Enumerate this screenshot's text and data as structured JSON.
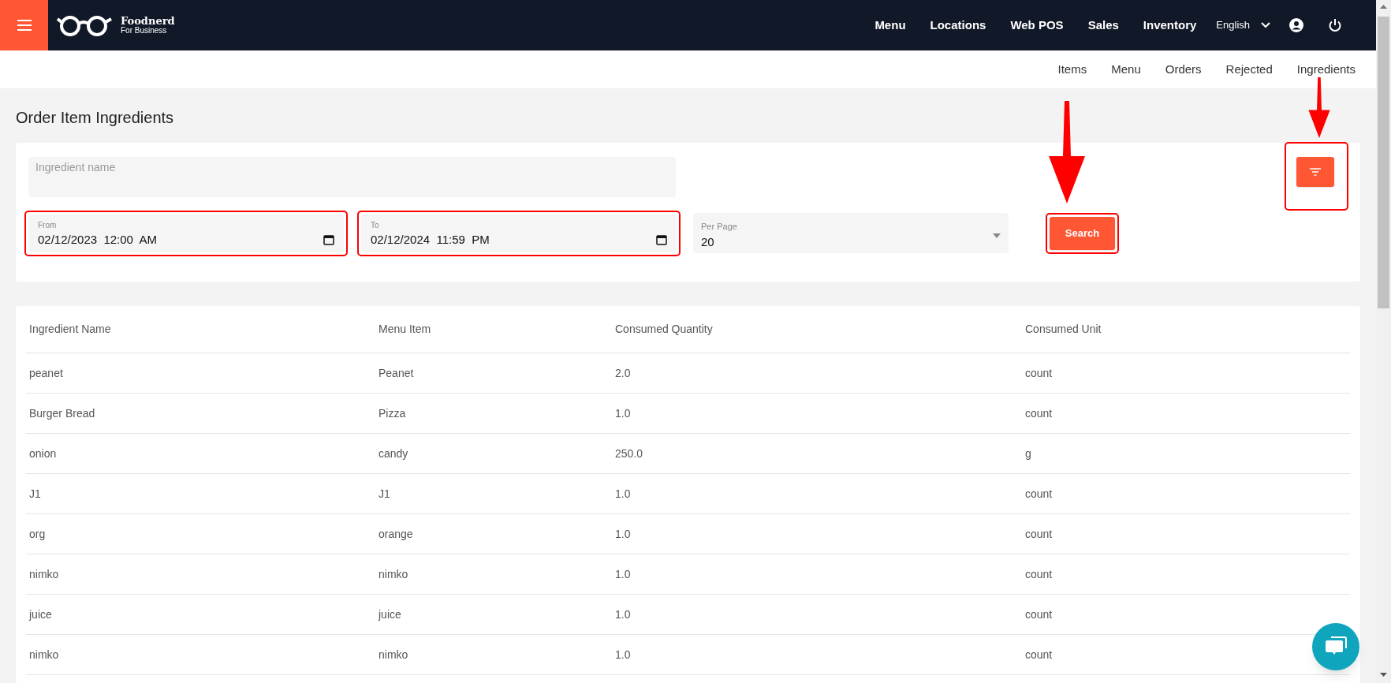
{
  "brand": {
    "name": "Foodnerd",
    "tagline": "For Business"
  },
  "top_nav": [
    "Menu",
    "Locations",
    "Web POS",
    "Sales",
    "Inventory"
  ],
  "language": "English",
  "sub_nav": [
    "Items",
    "Menu",
    "Orders",
    "Rejected",
    "Ingredients"
  ],
  "title": "Order Item Ingredients",
  "filters": {
    "ingredient": {
      "placeholder": "Ingredient name"
    },
    "from": {
      "label": "From",
      "value": "02/12/2023  12:00  AM",
      "highlighted": true
    },
    "to": {
      "label": "To",
      "value": "02/12/2024  11:59  PM",
      "highlighted": true
    },
    "per_page": {
      "label": "Per Page",
      "value": "20"
    },
    "search_button": {
      "label": "Search",
      "highlighted": true
    },
    "filter_button": {
      "highlighted": true
    }
  },
  "table": {
    "columns": [
      "Ingredient Name",
      "Menu Item",
      "Consumed Quantity",
      "Consumed Unit"
    ],
    "rows": [
      [
        "peanet",
        "Peanet",
        "2.0",
        "count"
      ],
      [
        "Burger Bread",
        "Pizza",
        "1.0",
        "count"
      ],
      [
        "onion",
        "candy",
        "250.0",
        "g"
      ],
      [
        "J1",
        "J1",
        "1.0",
        "count"
      ],
      [
        "org",
        "orange",
        "1.0",
        "count"
      ],
      [
        "nimko",
        "nimko",
        "1.0",
        "count"
      ],
      [
        "juice",
        "juice",
        "1.0",
        "count"
      ],
      [
        "nimko",
        "nimko",
        "1.0",
        "count"
      ]
    ]
  }
}
